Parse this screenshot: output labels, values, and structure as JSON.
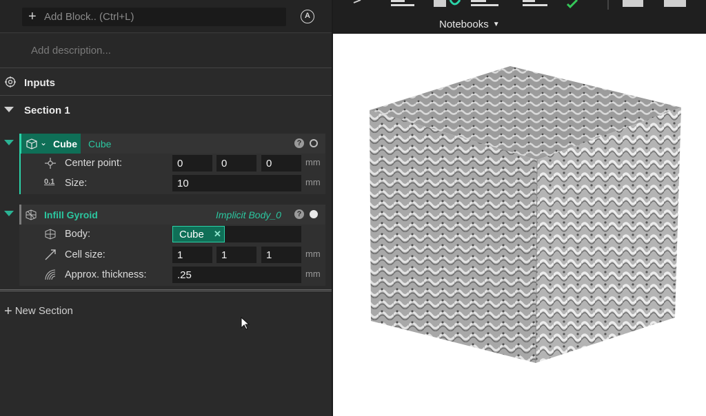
{
  "editor": {
    "add_block_placeholder": "Add Block.. (Ctrl+L)",
    "description_placeholder": "Add description...",
    "inputs_label": "Inputs",
    "section_title": "Section 1",
    "new_section_label": "New Section"
  },
  "blocks": [
    {
      "type_label": "Cube",
      "name": "Cube",
      "help_icon": "question-icon",
      "status_icon": "circle-outline-icon",
      "props": [
        {
          "label": "Center point:",
          "values": [
            "0",
            "0",
            "0"
          ],
          "unit": "mm",
          "icon": "point-icon"
        },
        {
          "label": "Size:",
          "values": [
            "10"
          ],
          "unit": "mm",
          "icon": "decimal-icon"
        }
      ]
    },
    {
      "type_label": "Infill Gyroid",
      "name": "Implicit Body_0",
      "help_icon": "question-icon",
      "status_icon": "circle-filled-icon",
      "props": [
        {
          "label": "Body:",
          "chip": "Cube",
          "icon": "lattice-icon"
        },
        {
          "label": "Cell size:",
          "values": [
            "1",
            "1",
            "1"
          ],
          "unit": "mm",
          "icon": "diagonal-arrow-icon"
        },
        {
          "label": "Approx. thickness:",
          "values": [
            ".25"
          ],
          "unit": "mm",
          "icon": "thickness-icon"
        }
      ]
    }
  ],
  "toolbar": {
    "notebooks_label": "Notebooks"
  },
  "colors": {
    "accent": "#2bd3a8",
    "accent_dark": "#0f6f57",
    "panel": "#2a2a2a",
    "viewport_bg": "#ffffff"
  }
}
